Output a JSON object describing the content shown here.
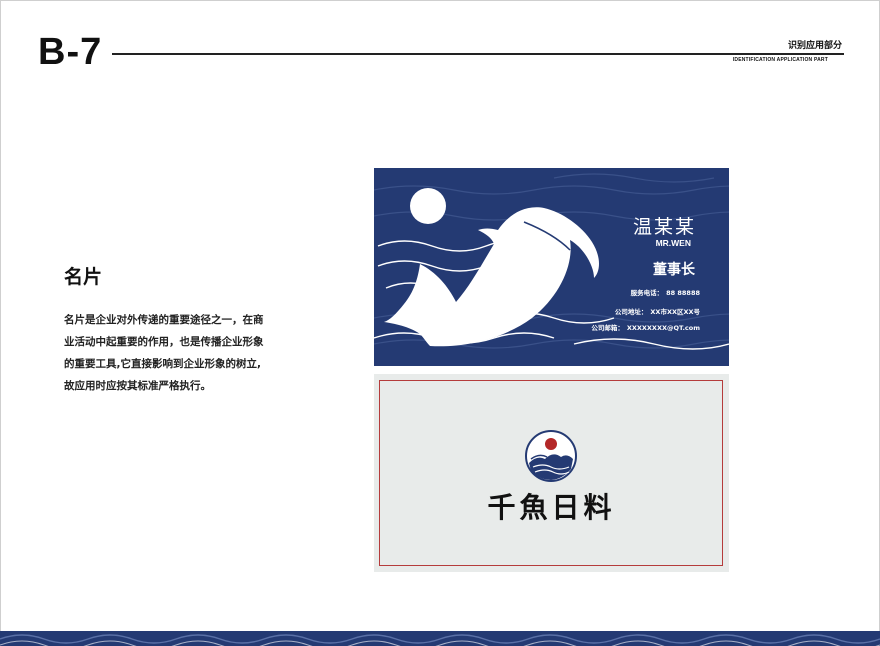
{
  "header": {
    "page_code": "B-7",
    "section_cn": "识别应用部分",
    "section_en": "IDENTIFICATION APPLICATION PART"
  },
  "content": {
    "title": "名片",
    "description_lines": [
      "名片是企业对外传递的重要途径之一，在商",
      "业活动中起重要的作用，也是传播企业形象",
      "的重要工具,它直接影响到企业形象的树立,",
      "故应用时应按其标准严格执行。"
    ]
  },
  "card_front": {
    "name": "温某某",
    "name_en": "MR.WEN",
    "job_title": "董事长",
    "phone_label": "服务电话：",
    "phone": "88 88888",
    "address_label": "公司地址：",
    "address": "XX市XX区XX号",
    "email_label": "公司邮箱：",
    "email": "XXXXXXXX@QT.com",
    "background_color": "#243a73"
  },
  "card_back": {
    "brand_name": "千魚日料",
    "frame_color": "#b53c3c",
    "background_color": "#e8ebea",
    "sun_color": "#b32727",
    "emblem_icon": "fish-wave-emblem-icon"
  },
  "footer": {
    "pattern_icon": "wave-pattern-icon",
    "color": "#243a73"
  }
}
